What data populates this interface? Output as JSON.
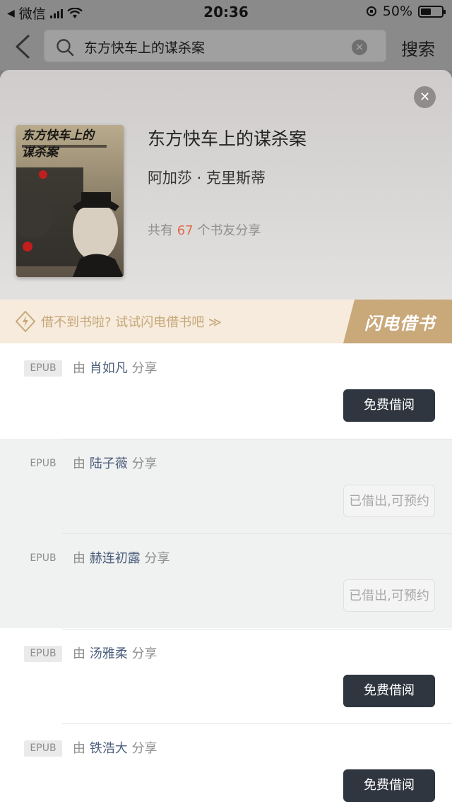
{
  "status_bar": {
    "carrier": "微信",
    "time": "20:36",
    "battery": "50%",
    "battery_level": 0.5
  },
  "header": {
    "search_query": "东方快车上的谋杀案",
    "search_button": "搜索"
  },
  "book": {
    "title": "东方快车上的谋杀案",
    "author": "阿加莎 · 克里斯蒂",
    "share_prefix": "共有",
    "share_count": "67",
    "share_suffix": "个书友分享",
    "cover_title": "东方快车上的谋杀案"
  },
  "promo": {
    "text": "借不到书啦? 试试闪电借书吧 ≫",
    "badge": "闪电借书"
  },
  "shares": [
    {
      "format": "EPUB",
      "by": "由",
      "user": "肖如凡",
      "action": "分享",
      "button": "免费借阅",
      "available": true
    },
    {
      "format": "EPUB",
      "by": "由",
      "user": "陆子薇",
      "action": "分享",
      "button": "已借出,可预约",
      "available": false
    },
    {
      "format": "EPUB",
      "by": "由",
      "user": "赫连初露",
      "action": "分享",
      "button": "已借出,可预约",
      "available": false
    },
    {
      "format": "EPUB",
      "by": "由",
      "user": "汤雅柔",
      "action": "分享",
      "button": "免费借阅",
      "available": true
    },
    {
      "format": "EPUB",
      "by": "由",
      "user": "铁浩大",
      "action": "分享",
      "button": "免费借阅",
      "available": true
    }
  ],
  "colors": {
    "primary_button": "#2f3640",
    "count_highlight": "#e06a4a",
    "promo_text": "#c7a779",
    "username": "#4c5e7c"
  }
}
